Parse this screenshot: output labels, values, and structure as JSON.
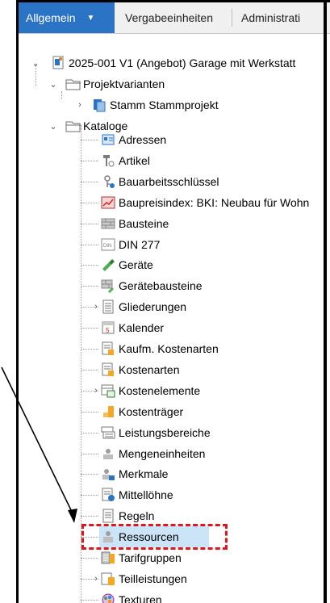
{
  "tabs": [
    {
      "label": "Allgemein",
      "active": true,
      "has_dropdown": true
    },
    {
      "label": "Vergabeeinheiten",
      "active": false
    },
    {
      "label": "Administrati",
      "active": false
    }
  ],
  "tree": {
    "root": {
      "label": "2025-001 V1 (Angebot) Garage mit Werkstatt",
      "icon": "project-icon"
    },
    "projektvarianten": {
      "label": "Projektvarianten",
      "icon": "folder-icon"
    },
    "stamm": {
      "label": "Stamm Stammprojekt",
      "icon": "project-variant-icon"
    },
    "kataloge": {
      "label": "Kataloge",
      "icon": "folder-icon"
    },
    "items": [
      {
        "label": "Adressen",
        "icon": "address-icon"
      },
      {
        "label": "Artikel",
        "icon": "article-icon"
      },
      {
        "label": "Bauarbeitsschlüssel",
        "icon": "key-icon"
      },
      {
        "label": "Baupreisindex: BKI: Neubau für Wohn",
        "icon": "chart-icon"
      },
      {
        "label": "Bausteine",
        "icon": "bricks-icon"
      },
      {
        "label": "DIN 277",
        "icon": "din-icon"
      },
      {
        "label": "Geräte",
        "icon": "tool-icon"
      },
      {
        "label": "Gerätebausteine",
        "icon": "bricks-tool-icon"
      },
      {
        "label": "Gliederungen",
        "icon": "list-icon"
      },
      {
        "label": "Kalender",
        "icon": "calendar-icon"
      },
      {
        "label": "Kaufm. Kostenarten",
        "icon": "cost-type-icon"
      },
      {
        "label": "Kostenarten",
        "icon": "cost-type-icon"
      },
      {
        "label": "Kostenelemente",
        "icon": "cost-element-icon"
      },
      {
        "label": "Kostenträger",
        "icon": "cost-carrier-icon"
      },
      {
        "label": "Leistungsbereiche",
        "icon": "service-area-icon"
      },
      {
        "label": "Mengeneinheiten",
        "icon": "unit-icon"
      },
      {
        "label": "Merkmale",
        "icon": "feature-icon"
      },
      {
        "label": "Mittellöhne",
        "icon": "wage-icon"
      },
      {
        "label": "Regeln",
        "icon": "rules-icon"
      },
      {
        "label": "Ressourcen",
        "icon": "resource-icon"
      },
      {
        "label": "Tarifgruppen",
        "icon": "tariff-icon"
      },
      {
        "label": "Teilleistungen",
        "icon": "partial-service-icon"
      },
      {
        "label": "Texturen",
        "icon": "texture-icon"
      }
    ]
  }
}
